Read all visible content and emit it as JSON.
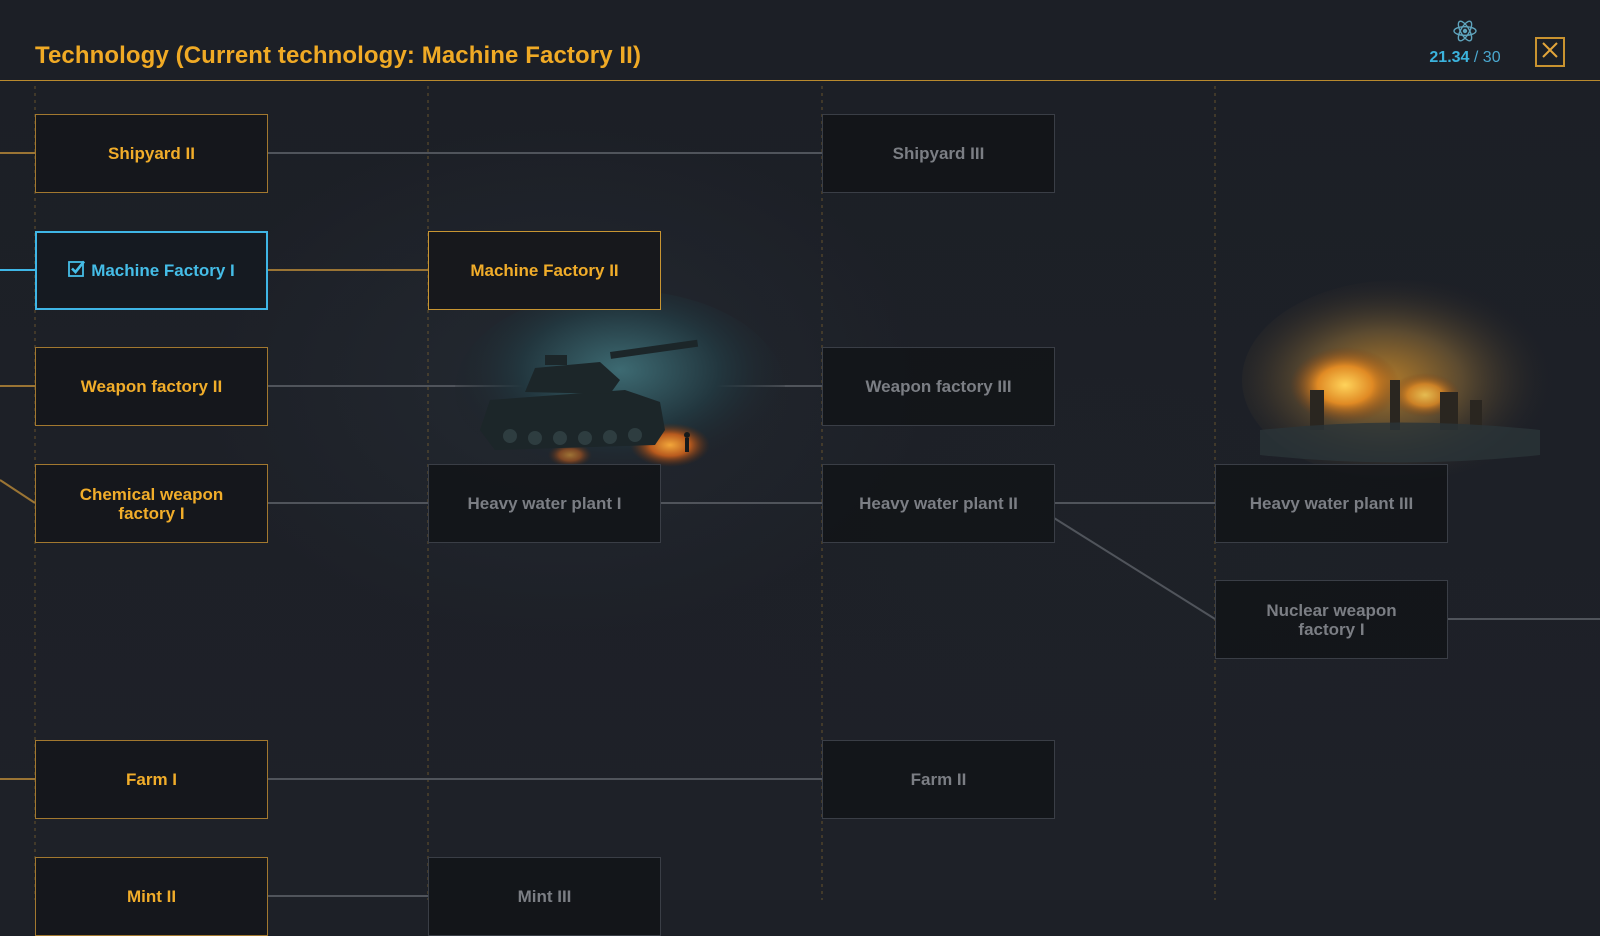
{
  "header": {
    "title": "Technology (Current technology: Machine Factory II)",
    "research_current": "21.34",
    "research_separator": " / ",
    "research_max": "30",
    "research_icon": "atom-icon",
    "close_icon": "close-icon"
  },
  "colors": {
    "accent": "#f0aa25",
    "researched": "#3fb6e6",
    "locked_text": "#7b7e84",
    "background": "#1d2027"
  },
  "tech_nodes": {
    "shipyard_2": {
      "label": "Shipyard II",
      "status": "available"
    },
    "shipyard_3": {
      "label": "Shipyard III",
      "status": "locked"
    },
    "machine_factory_1": {
      "label": "Machine Factory I",
      "status": "researched"
    },
    "machine_factory_2": {
      "label": "Machine Factory II",
      "status": "current"
    },
    "weapon_factory_2": {
      "label": "Weapon factory II",
      "status": "available"
    },
    "weapon_factory_3": {
      "label": "Weapon factory III",
      "status": "locked"
    },
    "chemical_weapon_factory_1": {
      "label": "Chemical weapon factory I",
      "status": "available"
    },
    "heavy_water_plant_1": {
      "label": "Heavy water plant I",
      "status": "locked"
    },
    "heavy_water_plant_2": {
      "label": "Heavy water plant II",
      "status": "locked"
    },
    "heavy_water_plant_3": {
      "label": "Heavy water plant III",
      "status": "locked"
    },
    "nuclear_weapon_factory_1": {
      "label": "Nuclear weapon factory I",
      "status": "locked"
    },
    "farm_1": {
      "label": "Farm I",
      "status": "available"
    },
    "farm_2": {
      "label": "Farm II",
      "status": "locked"
    },
    "mint_2": {
      "label": "Mint II",
      "status": "available"
    },
    "mint_3": {
      "label": "Mint III",
      "status": "locked"
    }
  }
}
